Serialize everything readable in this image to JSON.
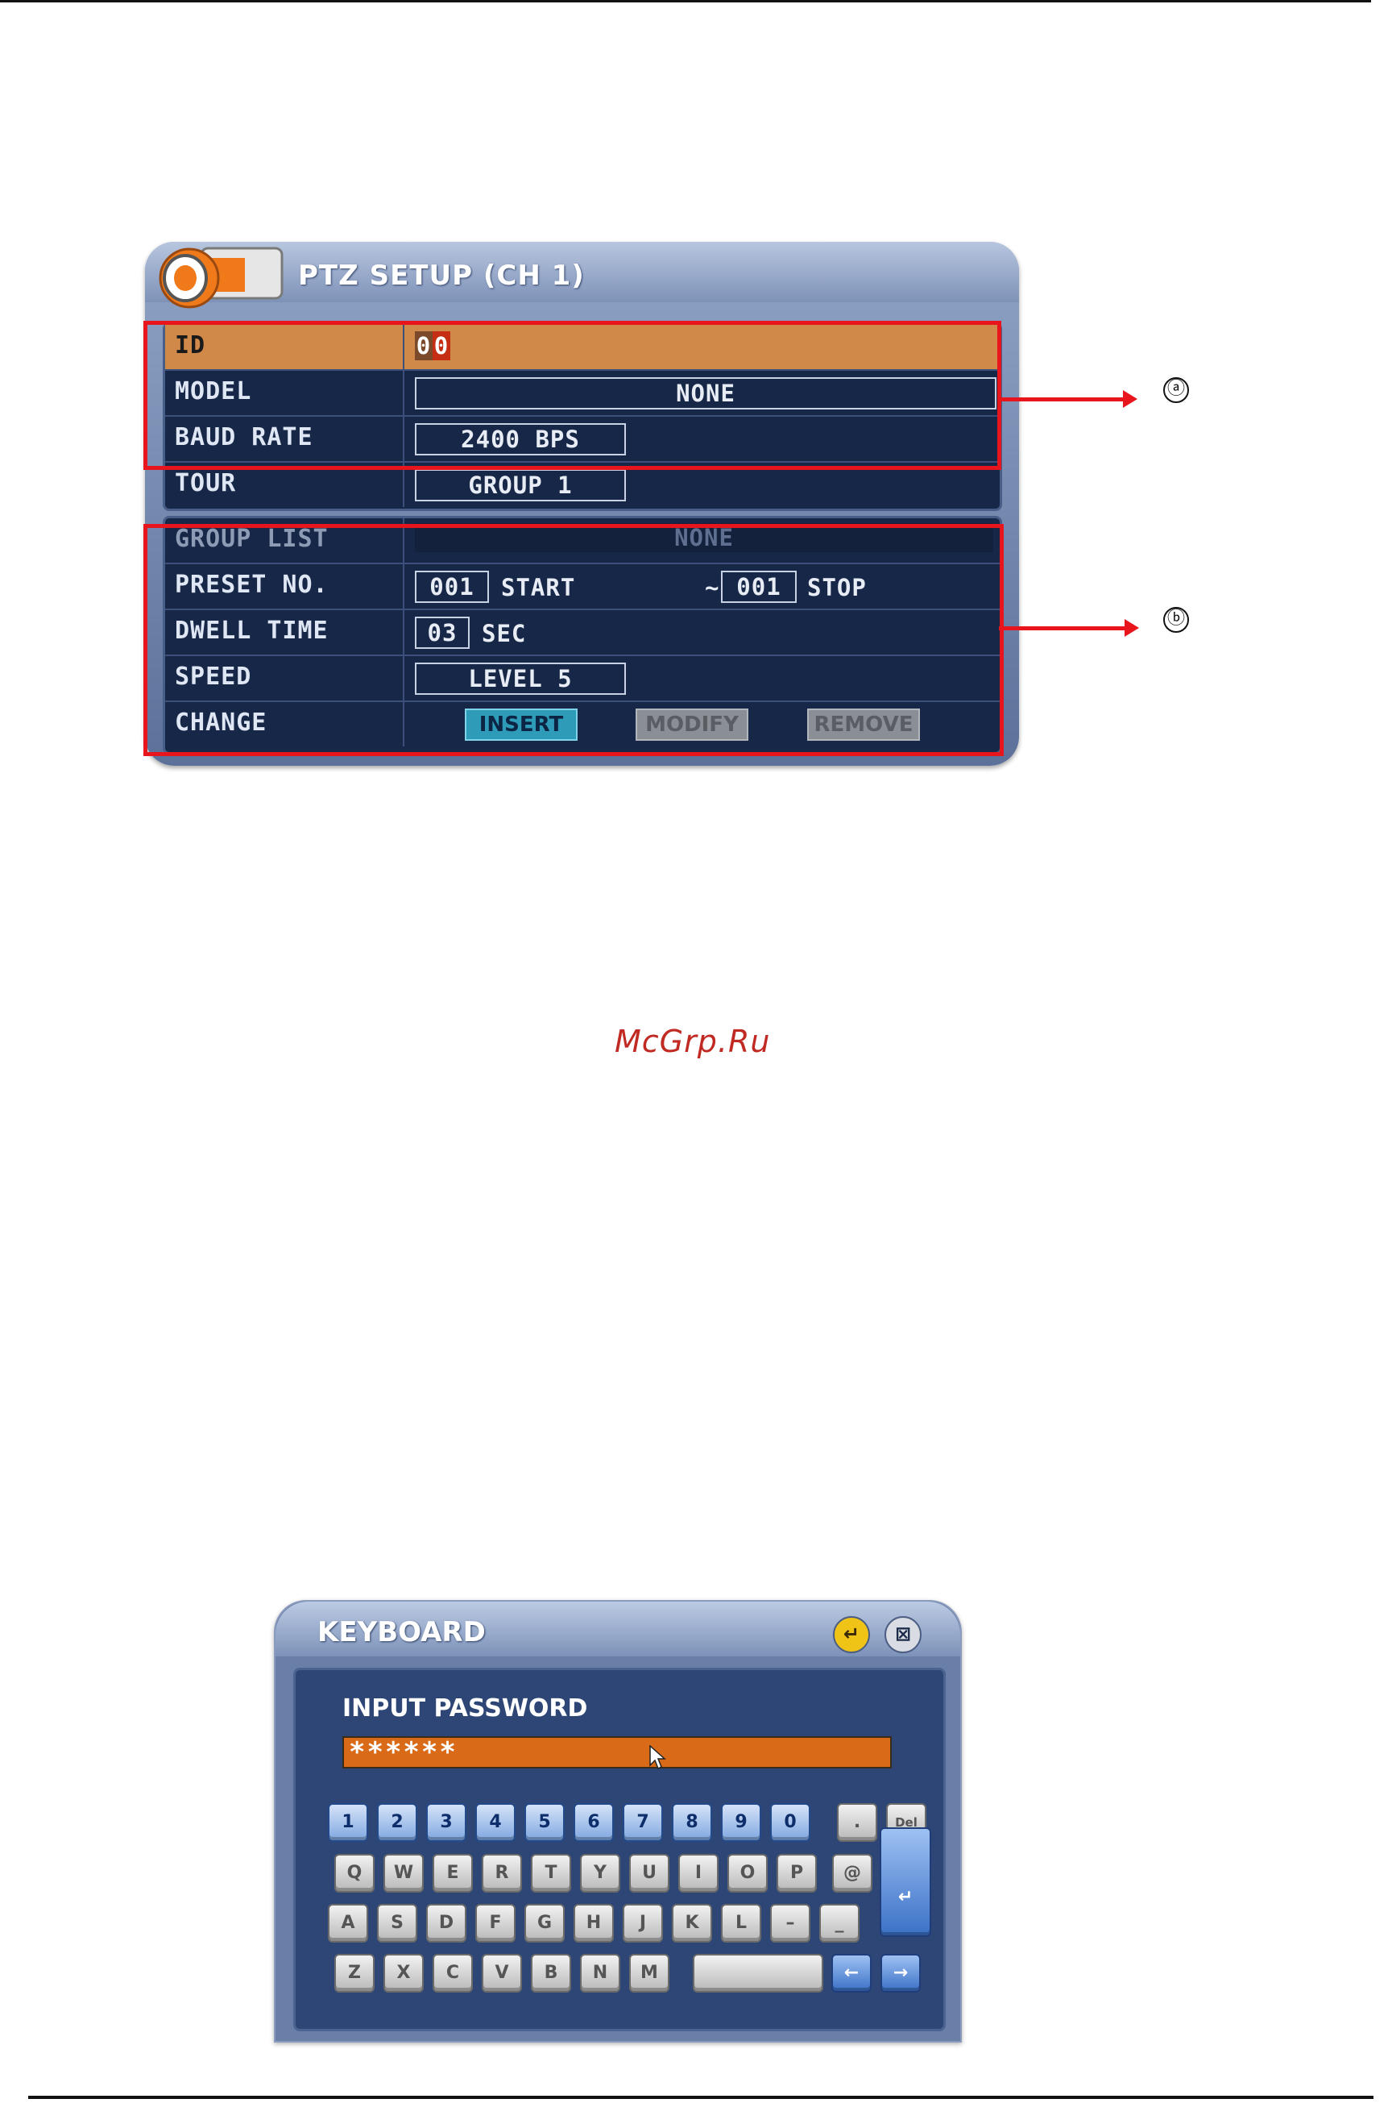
{
  "ptz": {
    "title": "PTZ SETUP (CH 1)",
    "rows": {
      "id": {
        "label": "ID",
        "value_a": "0",
        "value_b": "0"
      },
      "model": {
        "label": "MODEL",
        "value": "NONE"
      },
      "baud": {
        "label": "BAUD RATE",
        "value": "2400 BPS"
      },
      "tour": {
        "label": "TOUR",
        "value": "GROUP 1"
      },
      "group_list": {
        "label": "GROUP LIST",
        "value": "NONE"
      },
      "preset": {
        "label": "PRESET NO.",
        "start_value": "001",
        "start_label": "START",
        "tilde": "~",
        "stop_value": "001",
        "stop_label": "STOP"
      },
      "dwell": {
        "label": "DWELL TIME",
        "value": "03",
        "unit": "SEC"
      },
      "speed": {
        "label": "SPEED",
        "value": "LEVEL 5"
      },
      "change": {
        "label": "CHANGE",
        "insert": "INSERT",
        "modify": "MODIFY",
        "remove": "REMOVE"
      }
    }
  },
  "annotations": {
    "a": "ⓐ",
    "b": "ⓑ"
  },
  "watermark": "McGrp.Ru",
  "keyboard": {
    "title": "KEYBOARD",
    "enter_icon": "↵",
    "close_icon": "⊠",
    "prompt": "INPUT PASSWORD",
    "input_value": "******",
    "rows": [
      [
        "1",
        "2",
        "3",
        "4",
        "5",
        "6",
        "7",
        "8",
        "9",
        "0",
        ".",
        "Del"
      ],
      [
        "Q",
        "W",
        "E",
        "R",
        "T",
        "Y",
        "U",
        "I",
        "O",
        "P",
        "@"
      ],
      [
        "A",
        "S",
        "D",
        "F",
        "G",
        "H",
        "J",
        "K",
        "L",
        "–",
        "_"
      ],
      [
        "Z",
        "X",
        "C",
        "V",
        "B",
        "N",
        "M"
      ]
    ],
    "enter_key": "↵",
    "left_key": "←",
    "right_key": "→"
  },
  "colors": {
    "accent_red": "#e8151c",
    "selected_row": "#d1894a",
    "insert_active": "#2e9cb8"
  }
}
